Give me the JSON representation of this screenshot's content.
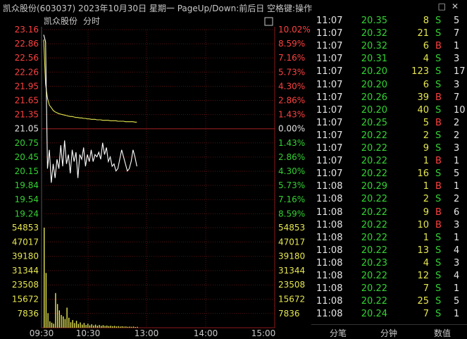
{
  "title_bar": {
    "text": "凯众股份(603037)  2023年10月30日  星期一  PageUp/Down:前后日  空格键:操作",
    "icons": [
      "□",
      "✕"
    ]
  },
  "chart_panel": {
    "header_name": "凯众股份",
    "header_mode": "分时",
    "price_ticks": [
      {
        "label": "23.16",
        "pct": "10.02%",
        "color": "#ff4040"
      },
      {
        "label": "22.86",
        "pct": "8.59%",
        "color": "#ff4040"
      },
      {
        "label": "22.56",
        "pct": "7.16%",
        "color": "#ff4040"
      },
      {
        "label": "22.26",
        "pct": "5.73%",
        "color": "#ff4040"
      },
      {
        "label": "21.95",
        "pct": "4.30%",
        "color": "#ff4040"
      },
      {
        "label": "21.65",
        "pct": "2.86%",
        "color": "#ff4040"
      },
      {
        "label": "21.35",
        "pct": "1.43%",
        "color": "#ff4040"
      },
      {
        "label": "21.05",
        "pct": "0.00%",
        "color": "#e0e0e0"
      },
      {
        "label": "20.75",
        "pct": "1.43%",
        "color": "#32d232"
      },
      {
        "label": "20.45",
        "pct": "2.86%",
        "color": "#32d232"
      },
      {
        "label": "20.15",
        "pct": "4.30%",
        "color": "#32d232"
      },
      {
        "label": "19.84",
        "pct": "5.73%",
        "color": "#32d232"
      },
      {
        "label": "19.54",
        "pct": "7.16%",
        "color": "#32d232"
      },
      {
        "label": "19.24",
        "pct": "8.59%",
        "color": "#32d232"
      }
    ],
    "volume_ticks": [
      "54853",
      "47017",
      "39180",
      "31344",
      "23508",
      "15672",
      "7836"
    ],
    "time_axis": [
      "09:30",
      "10:30",
      "13:00",
      "14:00",
      "15:00"
    ],
    "price_series": [
      22.95,
      22.0,
      21.7,
      21.55,
      21.5,
      21.44,
      21.41,
      21.39,
      21.37,
      21.36,
      21.35,
      21.34,
      21.33,
      21.32,
      21.31,
      21.31,
      21.3,
      21.29,
      21.29,
      21.28,
      21.28,
      21.27,
      21.27,
      21.26,
      21.26,
      21.25,
      21.25,
      21.25,
      21.24,
      21.24,
      21.24,
      21.23,
      21.23,
      21.23,
      21.23,
      21.22,
      21.22,
      21.22,
      21.22,
      21.21,
      21.21,
      21.21,
      21.21,
      21.2,
      21.2,
      21.2,
      21.2,
      21.2,
      21.19,
      21.19
    ],
    "avg_series": [
      23.05,
      22.9,
      20.2,
      20.6,
      19.9,
      20.3,
      20.0,
      20.4,
      20.2,
      20.7,
      20.25,
      20.8,
      20.3,
      20.5,
      20.1,
      20.6,
      20.35,
      20.55,
      20.0,
      20.5,
      20.4,
      20.65,
      20.25,
      20.5,
      20.35,
      20.6,
      20.35,
      20.5,
      20.45,
      20.55,
      20.4,
      20.75,
      20.5,
      20.65,
      20.35,
      20.45,
      20.25,
      20.3,
      20.15,
      20.2,
      20.4,
      20.6,
      20.45,
      20.3,
      20.15,
      20.2,
      20.35,
      20.6,
      20.45,
      20.25
    ],
    "volume_series": [
      54853,
      30000,
      8000,
      3500,
      2800,
      2200,
      19000,
      13000,
      9500,
      7000,
      6200,
      4800,
      11000,
      5500,
      3000,
      4200,
      2600,
      3800,
      2100,
      2900,
      1700,
      2600,
      1500,
      2200,
      1300,
      1900,
      1200,
      1700,
      1100,
      1500,
      1000,
      1400,
      1000,
      1200,
      900,
      1100,
      800,
      1000,
      700,
      900,
      600,
      800,
      600,
      700,
      500,
      600,
      500,
      600,
      400,
      500
    ]
  },
  "ticks_panel": {
    "rows": [
      {
        "time": "11:07",
        "price": "20.35",
        "vol": "8",
        "side": "S",
        "extra": "5"
      },
      {
        "time": "11:07",
        "price": "20.32",
        "vol": "21",
        "side": "S",
        "extra": "7"
      },
      {
        "time": "11:07",
        "price": "20.32",
        "vol": "6",
        "side": "B",
        "extra": "1"
      },
      {
        "time": "11:07",
        "price": "20.31",
        "vol": "4",
        "side": "S",
        "extra": "3"
      },
      {
        "time": "11:07",
        "price": "20.20",
        "vol": "123",
        "side": "S",
        "extra": "17"
      },
      {
        "time": "11:07",
        "price": "20.20",
        "vol": "6",
        "side": "S",
        "extra": "3"
      },
      {
        "time": "11:07",
        "price": "20.26",
        "vol": "39",
        "side": "B",
        "extra": "7"
      },
      {
        "time": "11:07",
        "price": "20.20",
        "vol": "40",
        "side": "S",
        "extra": "10"
      },
      {
        "time": "11:07",
        "price": "20.25",
        "vol": "5",
        "side": "B",
        "extra": "2"
      },
      {
        "time": "11:07",
        "price": "20.22",
        "vol": "2",
        "side": "S",
        "extra": "2"
      },
      {
        "time": "11:07",
        "price": "20.22",
        "vol": "9",
        "side": "S",
        "extra": "3"
      },
      {
        "time": "11:07",
        "price": "20.22",
        "vol": "1",
        "side": "B",
        "extra": "1"
      },
      {
        "time": "11:07",
        "price": "20.22",
        "vol": "16",
        "side": "S",
        "extra": "5"
      },
      {
        "time": "11:08",
        "price": "20.29",
        "vol": "1",
        "side": "B",
        "extra": "1"
      },
      {
        "time": "11:08",
        "price": "20.22",
        "vol": "2",
        "side": "S",
        "extra": "2"
      },
      {
        "time": "11:08",
        "price": "20.22",
        "vol": "9",
        "side": "B",
        "extra": "6"
      },
      {
        "time": "11:08",
        "price": "20.22",
        "vol": "10",
        "side": "B",
        "extra": "3"
      },
      {
        "time": "11:08",
        "price": "20.22",
        "vol": "1",
        "side": "S",
        "extra": "1"
      },
      {
        "time": "11:08",
        "price": "20.22",
        "vol": "13",
        "side": "S",
        "extra": "4"
      },
      {
        "time": "11:08",
        "price": "20.23",
        "vol": "4",
        "side": "S",
        "extra": "3"
      },
      {
        "time": "11:08",
        "price": "20.22",
        "vol": "12",
        "side": "S",
        "extra": "4"
      },
      {
        "time": "11:08",
        "price": "20.22",
        "vol": "7",
        "side": "S",
        "extra": "1"
      },
      {
        "time": "11:08",
        "price": "20.22",
        "vol": "25",
        "side": "S",
        "extra": "5"
      },
      {
        "time": "11:08",
        "price": "20.24",
        "vol": "7",
        "side": "S",
        "extra": "1"
      }
    ],
    "tabs": [
      "分笔",
      "分钟",
      "数值"
    ]
  },
  "colors": {
    "up": "#ff4040",
    "down": "#32d232",
    "flat": "#e0e0e0",
    "volume": "#e6e651",
    "price_line": "#ffffff",
    "avg_line": "#e6e651",
    "grid": "#8a1a1a"
  }
}
